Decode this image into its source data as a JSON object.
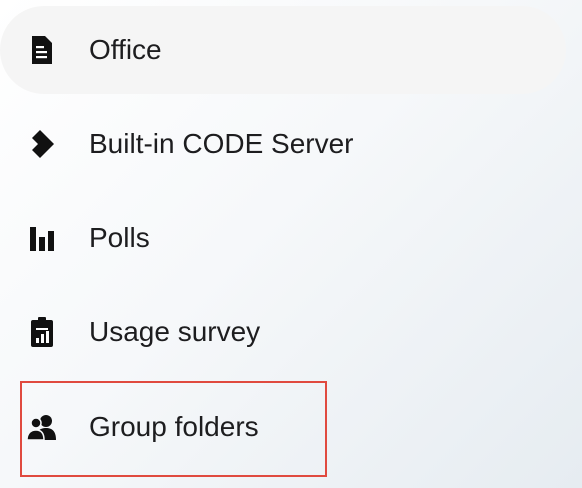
{
  "menu": {
    "items": [
      {
        "label": "Office",
        "icon": "document-icon",
        "active": true
      },
      {
        "label": "Built-in CODE Server",
        "icon": "code-server-icon",
        "active": false
      },
      {
        "label": "Polls",
        "icon": "bar-chart-icon",
        "active": false
      },
      {
        "label": "Usage survey",
        "icon": "clipboard-chart-icon",
        "active": false
      },
      {
        "label": "Group folders",
        "icon": "group-icon",
        "active": false
      }
    ]
  },
  "highlight": {
    "target": "Group folders",
    "color": "#e04a3f"
  },
  "colors": {
    "active_background": "#f5f5f5",
    "text": "#1d1d1f"
  }
}
